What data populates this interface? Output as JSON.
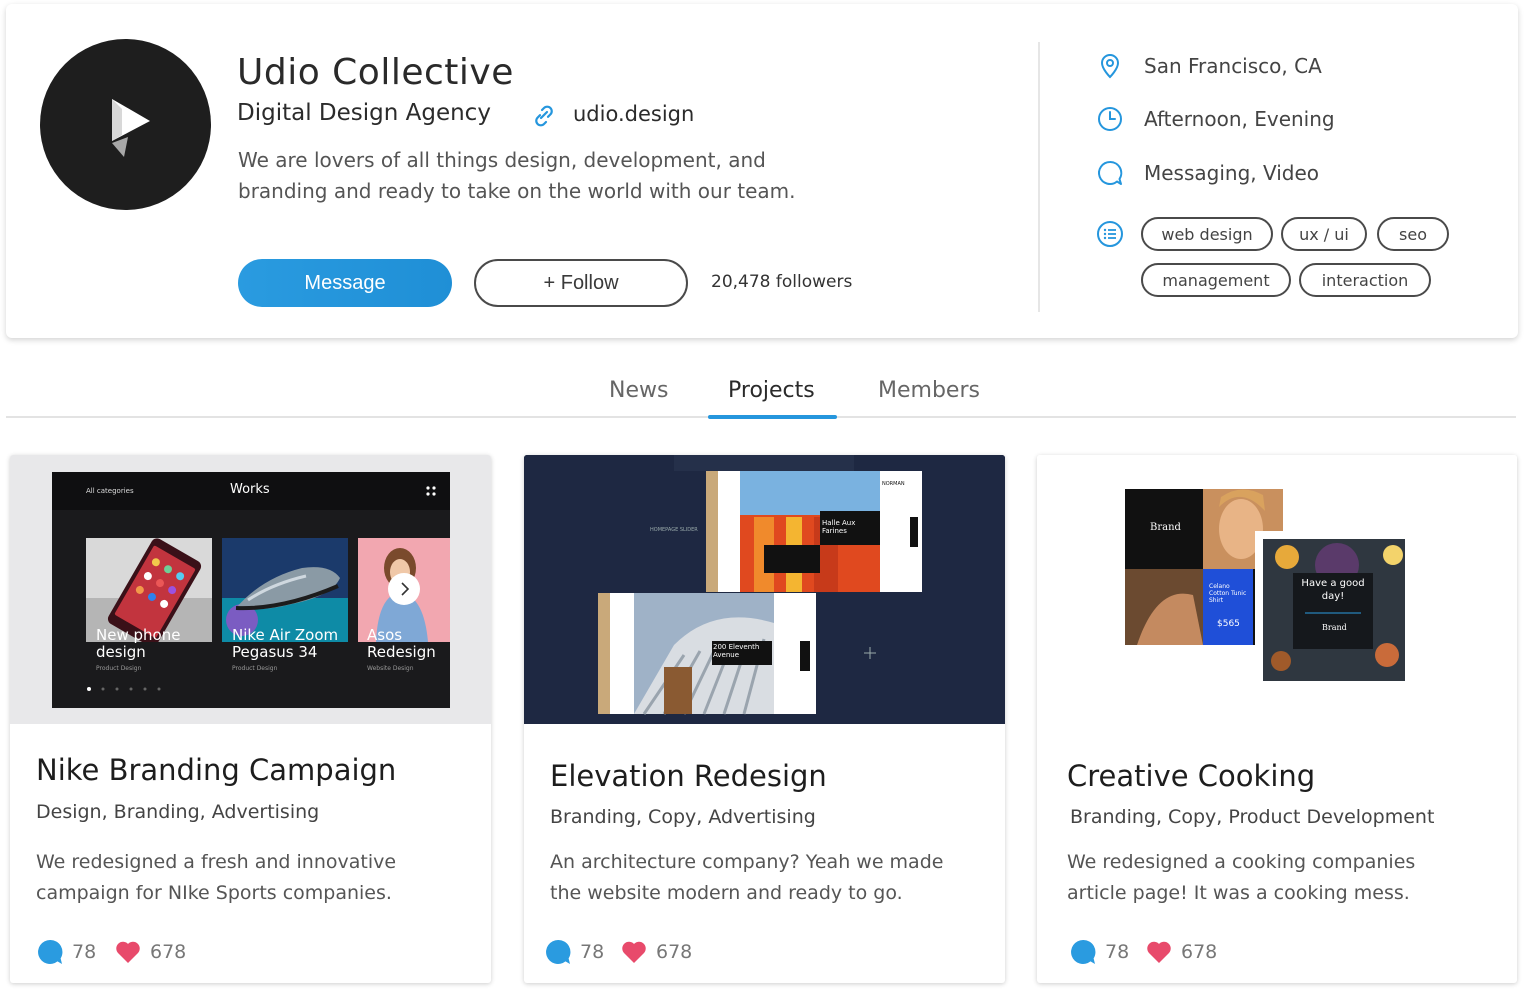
{
  "profile": {
    "name": "Udio Collective",
    "subtitle": "Digital Design Agency",
    "website": "udio.design",
    "bio_line1": "We are lovers of all things design, development, and",
    "bio_line2": "branding and ready to take on the world with our team.",
    "message_label": "Message",
    "follow_label": "+ Follow",
    "followers": "20,478 followers",
    "location": "San Francisco, CA",
    "availability": "Afternoon, Evening",
    "contact": "Messaging, Video",
    "tags": [
      "web design",
      "ux / ui",
      "seo",
      "management",
      "interaction"
    ]
  },
  "tabs": [
    {
      "label": "News",
      "active": false
    },
    {
      "label": "Projects",
      "active": true
    },
    {
      "label": "Members",
      "active": false
    }
  ],
  "projects": [
    {
      "title": "Nike Branding Campaign",
      "tags": "Design, Branding, Advertising",
      "desc_line1": "We redesigned a fresh and innovative",
      "desc_line2": "campaign for NIke Sports companies.",
      "comments": "78",
      "likes": "678",
      "thumb": {
        "category": "All categories",
        "heading": "Works",
        "tiles": [
          {
            "line1": "New phone",
            "line2": "design",
            "sub": "Product Design"
          },
          {
            "line1": "Nike Air Zoom",
            "line2": "Pegasus 34",
            "sub": "Product Design"
          },
          {
            "line1": "Asos",
            "line2": "Redesign",
            "sub": "Website Design"
          }
        ]
      }
    },
    {
      "title": "Elevation Redesign",
      "tags": "Branding, Copy, Advertising",
      "desc_line1": "An architecture company? Yeah we made",
      "desc_line2": "the website modern and ready to go.",
      "comments": "78",
      "likes": "678",
      "thumb": {
        "label": "HOMEPAGE SLIDER",
        "brand": "NORMAN",
        "caption1": "Halle Aux Farines",
        "caption2": "200 Eleventh Avenue"
      }
    },
    {
      "title": "Creative Cooking",
      "tags": "Branding, Copy, Product Development",
      "desc_line1": "We redesigned a cooking companies",
      "desc_line2": "article page! It was a cooking mess.",
      "comments": "78",
      "likes": "678",
      "thumb": {
        "brand": "Brand",
        "product": "Celano Cotton Tunic Shirt",
        "price": "$565",
        "greeting": "Have a good day!"
      }
    }
  ],
  "colors": {
    "accent": "#2596dd",
    "heart": "#e84a6b",
    "dark": "#1e1e1e",
    "navy": "#1e2842"
  },
  "icons": [
    "location-pin-icon",
    "clock-icon",
    "chat-bubble-icon",
    "list-icon",
    "link-icon",
    "comment-icon",
    "heart-icon",
    "chevron-right-icon",
    "grid-dots-icon"
  ]
}
